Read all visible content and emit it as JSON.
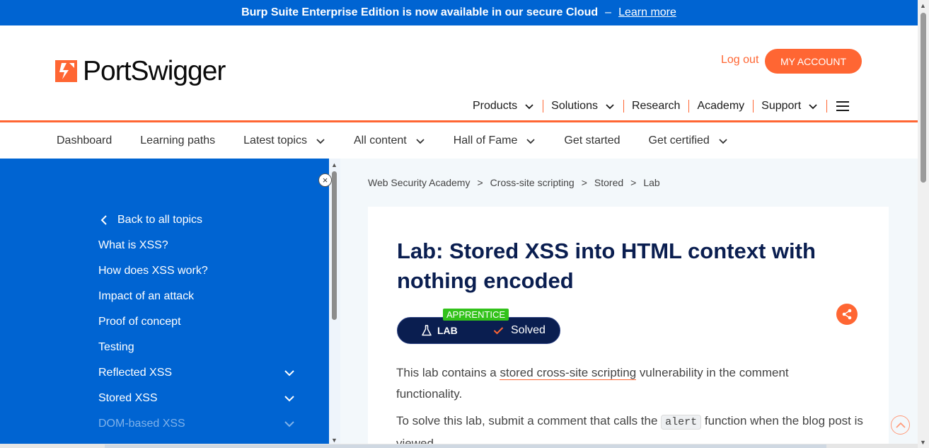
{
  "banner": {
    "text": "Burp Suite Enterprise Edition is now available in our secure Cloud",
    "separator": "–",
    "link": "Learn more"
  },
  "header": {
    "logo_text": "PortSwigger",
    "logout": "Log out",
    "account": "MY ACCOUNT",
    "nav": [
      "Products",
      "Solutions",
      "Research",
      "Academy",
      "Support"
    ]
  },
  "subnav": [
    "Dashboard",
    "Learning paths",
    "Latest topics",
    "All content",
    "Hall of Fame",
    "Get started",
    "Get certified"
  ],
  "sidebar": {
    "back": "Back to all topics",
    "items": [
      "What is XSS?",
      "How does XSS work?",
      "Impact of an attack",
      "Proof of concept",
      "Testing",
      "Reflected XSS",
      "Stored XSS",
      "DOM-based XSS"
    ],
    "close": "×"
  },
  "breadcrumb": [
    "Web Security Academy",
    ">",
    "Cross-site scripting",
    ">",
    "Stored",
    ">",
    "Lab"
  ],
  "lab": {
    "title": "Lab: Stored XSS into HTML context with nothing encoded",
    "level": "APPRENTICE",
    "badge_label": "LAB",
    "status": "Solved",
    "para1_a": "This lab contains a ",
    "para1_link": "stored cross-site scripting",
    "para1_b": " vulnerability in the comment functionality.",
    "para2_a": "To solve this lab, submit a comment that calls the ",
    "para2_code": "alert",
    "para2_b": " function when the blog post is viewed."
  },
  "colors": {
    "brand_orange": "#ff6633",
    "banner_blue": "#0064d2",
    "title_navy": "#0a1e50",
    "apprentice_green": "#32c21a"
  }
}
